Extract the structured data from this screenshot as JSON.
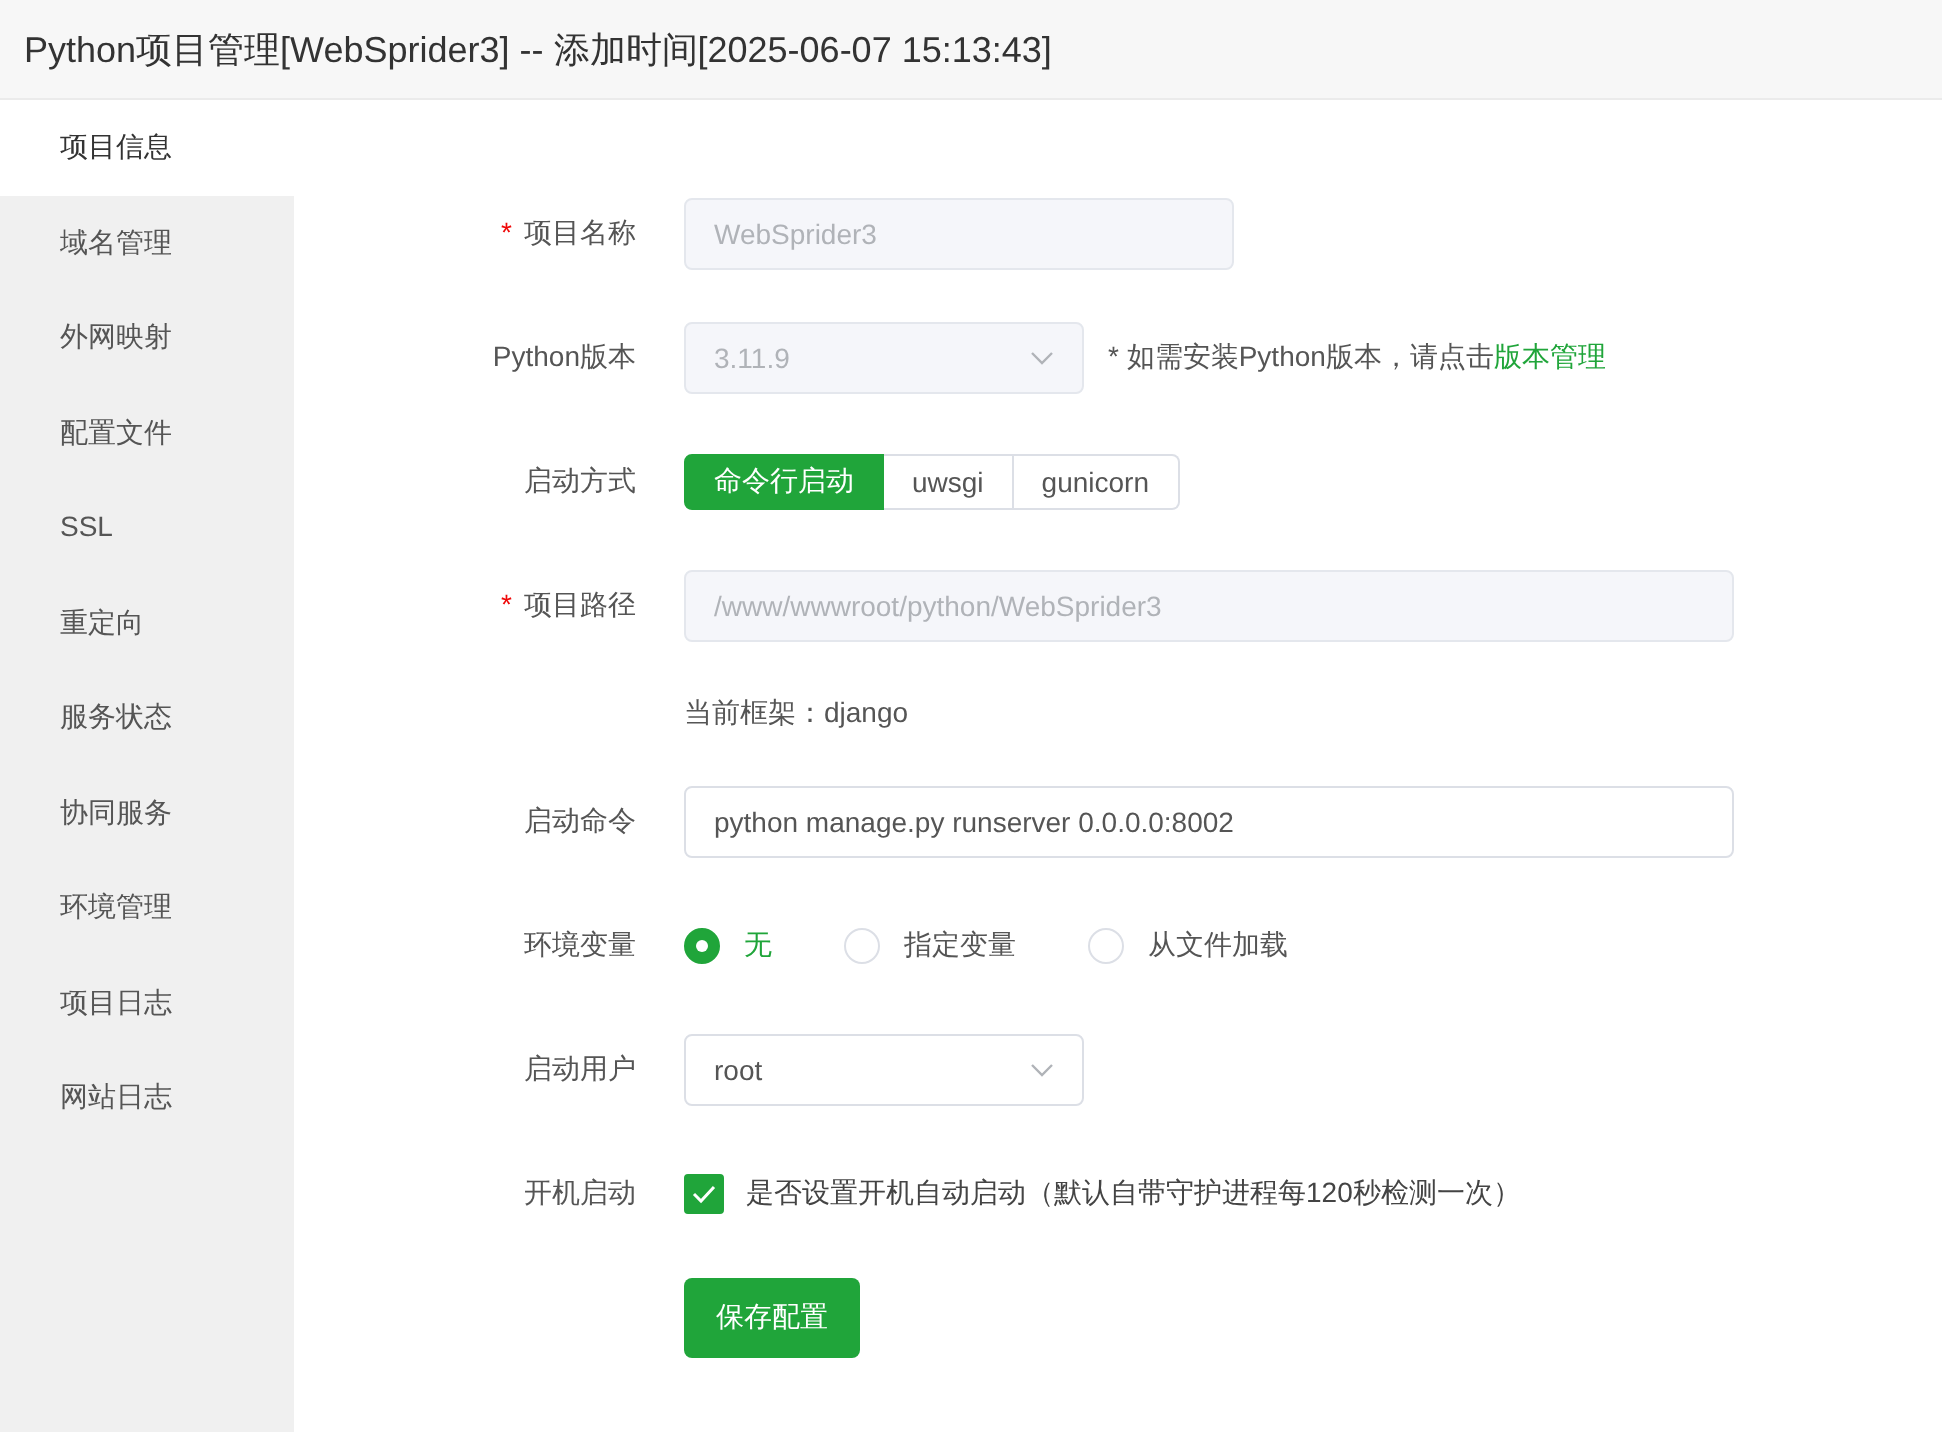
{
  "window": {
    "title": "Python项目管理[WebSprider3] -- 添加时间[2025-06-07 15:13:43]"
  },
  "sidebar": {
    "items": [
      {
        "label": "项目信息",
        "selected": true
      },
      {
        "label": "域名管理",
        "selected": false
      },
      {
        "label": "外网映射",
        "selected": false
      },
      {
        "label": "配置文件",
        "selected": false
      },
      {
        "label": "SSL",
        "selected": false
      },
      {
        "label": "重定向",
        "selected": false
      },
      {
        "label": "服务状态",
        "selected": false
      },
      {
        "label": "协同服务",
        "selected": false
      },
      {
        "label": "环境管理",
        "selected": false
      },
      {
        "label": "项目日志",
        "selected": false
      },
      {
        "label": "网站日志",
        "selected": false
      }
    ]
  },
  "form": {
    "fields": [
      {
        "kind": "text",
        "label": "项目名称",
        "required_mark": "*",
        "value": "WebSprider3",
        "disabled": true
      },
      {
        "kind": "select",
        "label": "Python版本",
        "value": "3.11.9",
        "disabled": true,
        "note": "* 如需安装Python版本，请点击",
        "note_link": "版本管理"
      },
      {
        "kind": "segmented",
        "label": "启动方式",
        "options": [
          {
            "label": "命令行启动",
            "selected": true
          },
          {
            "label": "uwsgi",
            "selected": false
          },
          {
            "label": "gunicorn",
            "selected": false
          }
        ]
      },
      {
        "kind": "text",
        "label": "项目路径",
        "required_mark": "*",
        "value": "/www/wwwroot/python/WebSprider3",
        "disabled": true
      },
      {
        "kind": "info",
        "text": "当前框架：django"
      },
      {
        "kind": "text",
        "label": "启动命令",
        "value": "python manage.py runserver 0.0.0.0:8002",
        "disabled": false
      },
      {
        "kind": "radio",
        "label": "环境变量",
        "options": [
          {
            "label": "无",
            "selected": true
          },
          {
            "label": "指定变量",
            "selected": false
          },
          {
            "label": "从文件加载",
            "selected": false
          }
        ]
      },
      {
        "kind": "select",
        "label": "启动用户",
        "value": "root",
        "disabled": false
      },
      {
        "kind": "checkbox",
        "label": "开机启动",
        "checked": true,
        "text": "是否设置开机自动启动（默认自带守护进程每120秒检测一次）"
      },
      {
        "kind": "button",
        "text": "保存配置"
      }
    ]
  }
}
